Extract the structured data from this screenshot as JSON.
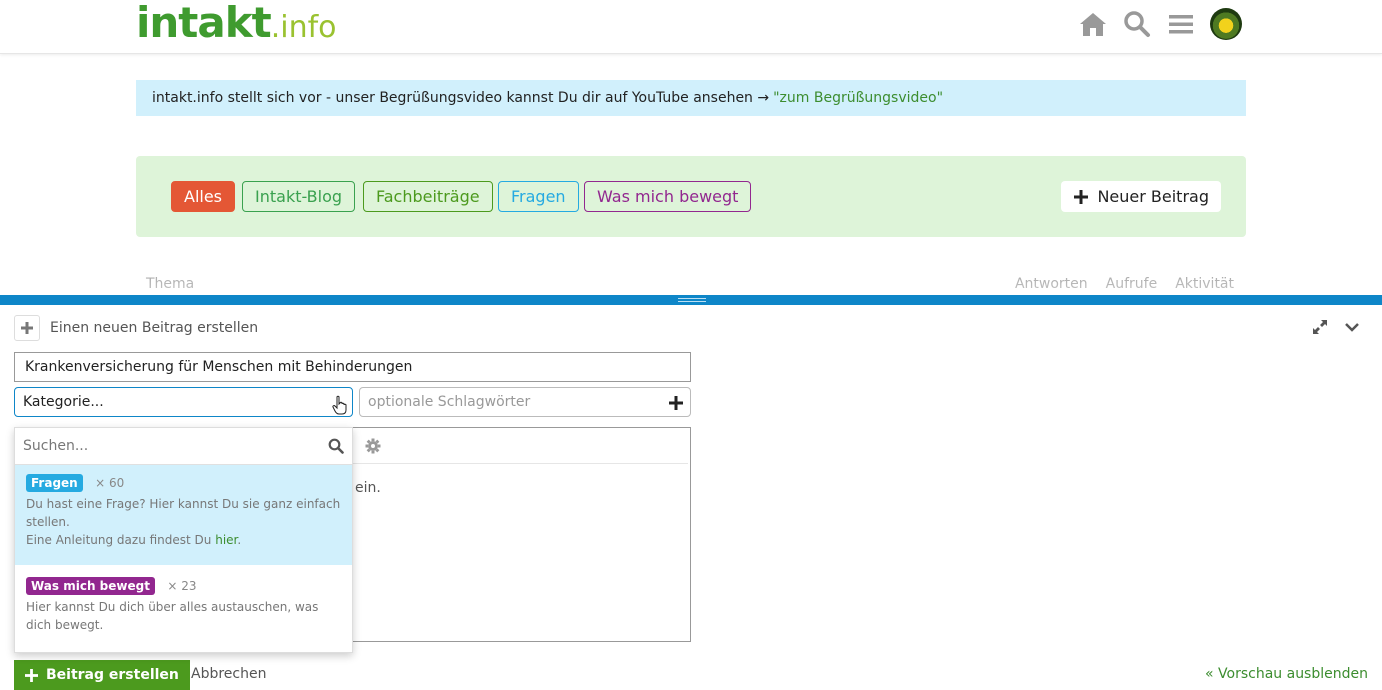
{
  "header": {
    "logo_main": "intakt",
    "logo_tld": ".info"
  },
  "banner": {
    "text": "intakt.info stellt sich vor - unser Begrüßungsvideo kannst Du dir auf YouTube ansehen →",
    "link": "\"zum Begrüßungsvideo\""
  },
  "categories": {
    "alles": "Alles",
    "blog": "Intakt-Blog",
    "fach": "Fachbeiträge",
    "fragen": "Fragen",
    "bewegt": "Was mich bewegt",
    "new_topic": "Neuer Beitrag"
  },
  "table_header": {
    "thema": "Thema",
    "antworten": "Antworten",
    "aufrufe": "Aufrufe",
    "aktivitaet": "Aktivität"
  },
  "composer": {
    "action_title": "Einen neuen Beitrag erstellen",
    "title_value": "Krankenversicherung für Menschen mit Behinderungen",
    "category_placeholder": "Kategorie...",
    "tags_placeholder": "optionale Schlagwörter",
    "editor_text_fragment": "ein.",
    "dropdown": {
      "search_placeholder": "Suchen...",
      "items": [
        {
          "name": "Fragen",
          "count": "× 60",
          "desc_line1": "Du hast eine Frage? Hier kannst Du sie ganz einfach stellen.",
          "desc_line2_prefix": "Eine Anleitung dazu findest Du ",
          "desc_line2_link": "hier",
          "desc_line2_suffix": "."
        },
        {
          "name": "Was mich bewegt",
          "count": "× 23",
          "desc_line1": "Hier kannst Du dich über alles austauschen, was dich bewegt."
        }
      ]
    },
    "create_label": "Beitrag erstellen",
    "cancel_label": "Abbrechen",
    "preview_label": "« Vorschau ausblenden"
  },
  "colors": {
    "brand_green": "#3f9b2f",
    "accent_blue": "#0e86c8",
    "fragen": "#25aae1",
    "bewegt": "#92278f",
    "alles": "#e45735"
  }
}
